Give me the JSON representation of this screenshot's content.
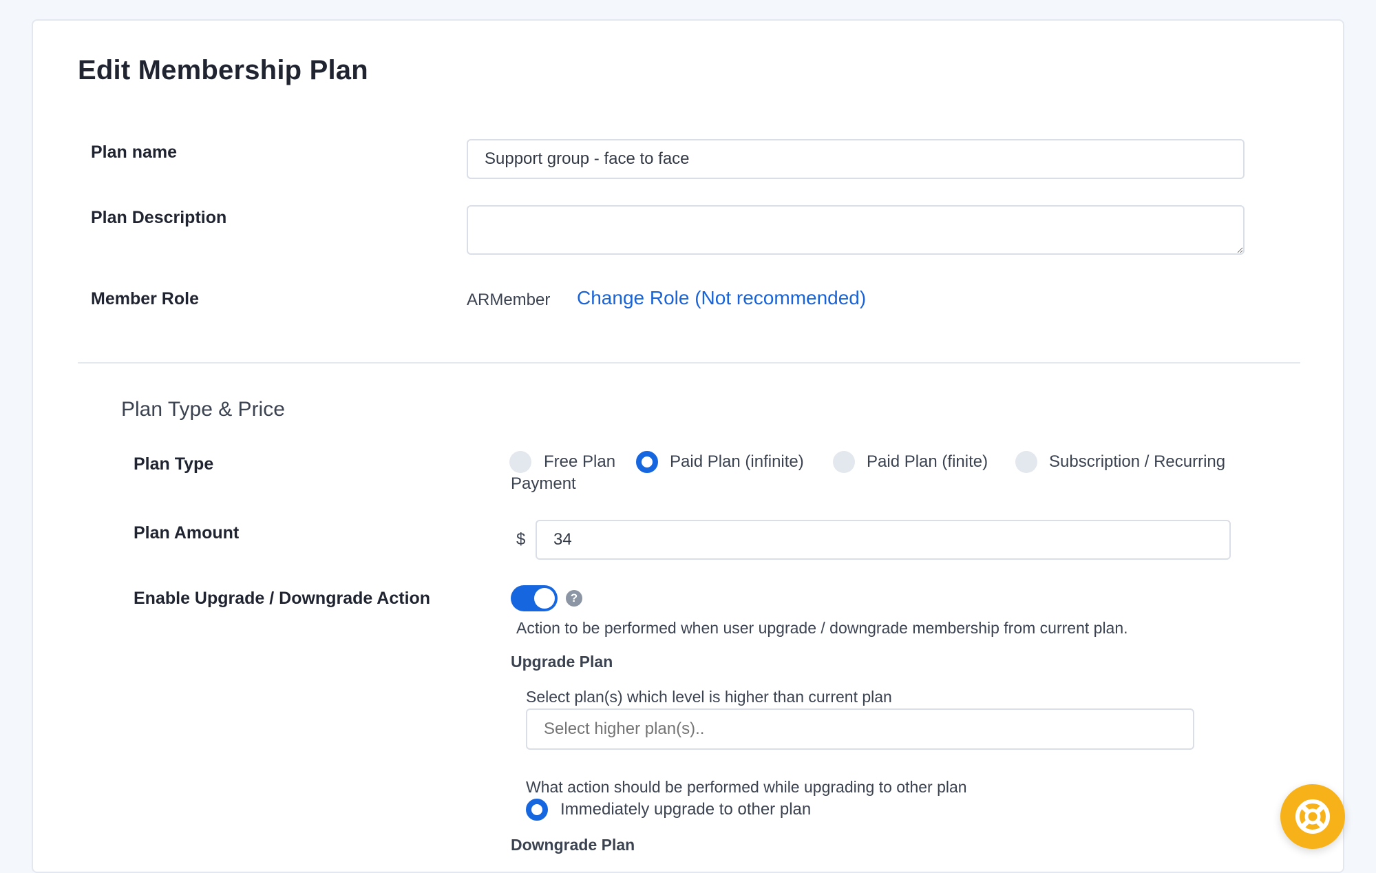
{
  "title": "Edit Membership Plan",
  "form": {
    "plan_name_label": "Plan name",
    "plan_name_value": "Support group - face to face",
    "plan_description_label": "Plan Description",
    "plan_description_value": "",
    "member_role_label": "Member Role",
    "member_role_value": "ARMember",
    "change_role_link": "Change Role (Not recommended)"
  },
  "plan_section": {
    "title": "Plan Type & Price",
    "plan_type_label": "Plan Type",
    "plan_types": [
      {
        "label": "Free Plan",
        "selected": false
      },
      {
        "label": "Paid Plan (infinite)",
        "selected": true
      },
      {
        "label": "Paid Plan (finite)",
        "selected": false
      },
      {
        "label": "Subscription / Recurring",
        "selected": false
      }
    ],
    "plan_type_wrap": "Payment",
    "plan_amount_label": "Plan Amount",
    "currency_symbol": "$",
    "plan_amount_value": "34",
    "upgrade_label": "Enable Upgrade / Downgrade Action",
    "upgrade_enabled": true,
    "help_glyph": "?",
    "upgrade_description": "Action to be performed when user upgrade / downgrade membership from current plan.",
    "upgrade_plan_title": "Upgrade Plan",
    "upgrade_select_label": "Select plan(s) which level is higher than current plan",
    "upgrade_select_placeholder": "Select higher plan(s)..",
    "upgrade_action_question": "What action should be performed while upgrading to other plan",
    "upgrade_action_option": "Immediately upgrade to other plan",
    "downgrade_plan_title": "Downgrade Plan"
  },
  "colors": {
    "accent": "#1666e0",
    "link": "#1a63d6",
    "support_button": "#f7b21a"
  },
  "icons": {
    "help": "question-circle-icon",
    "support": "lifebuoy-icon"
  }
}
